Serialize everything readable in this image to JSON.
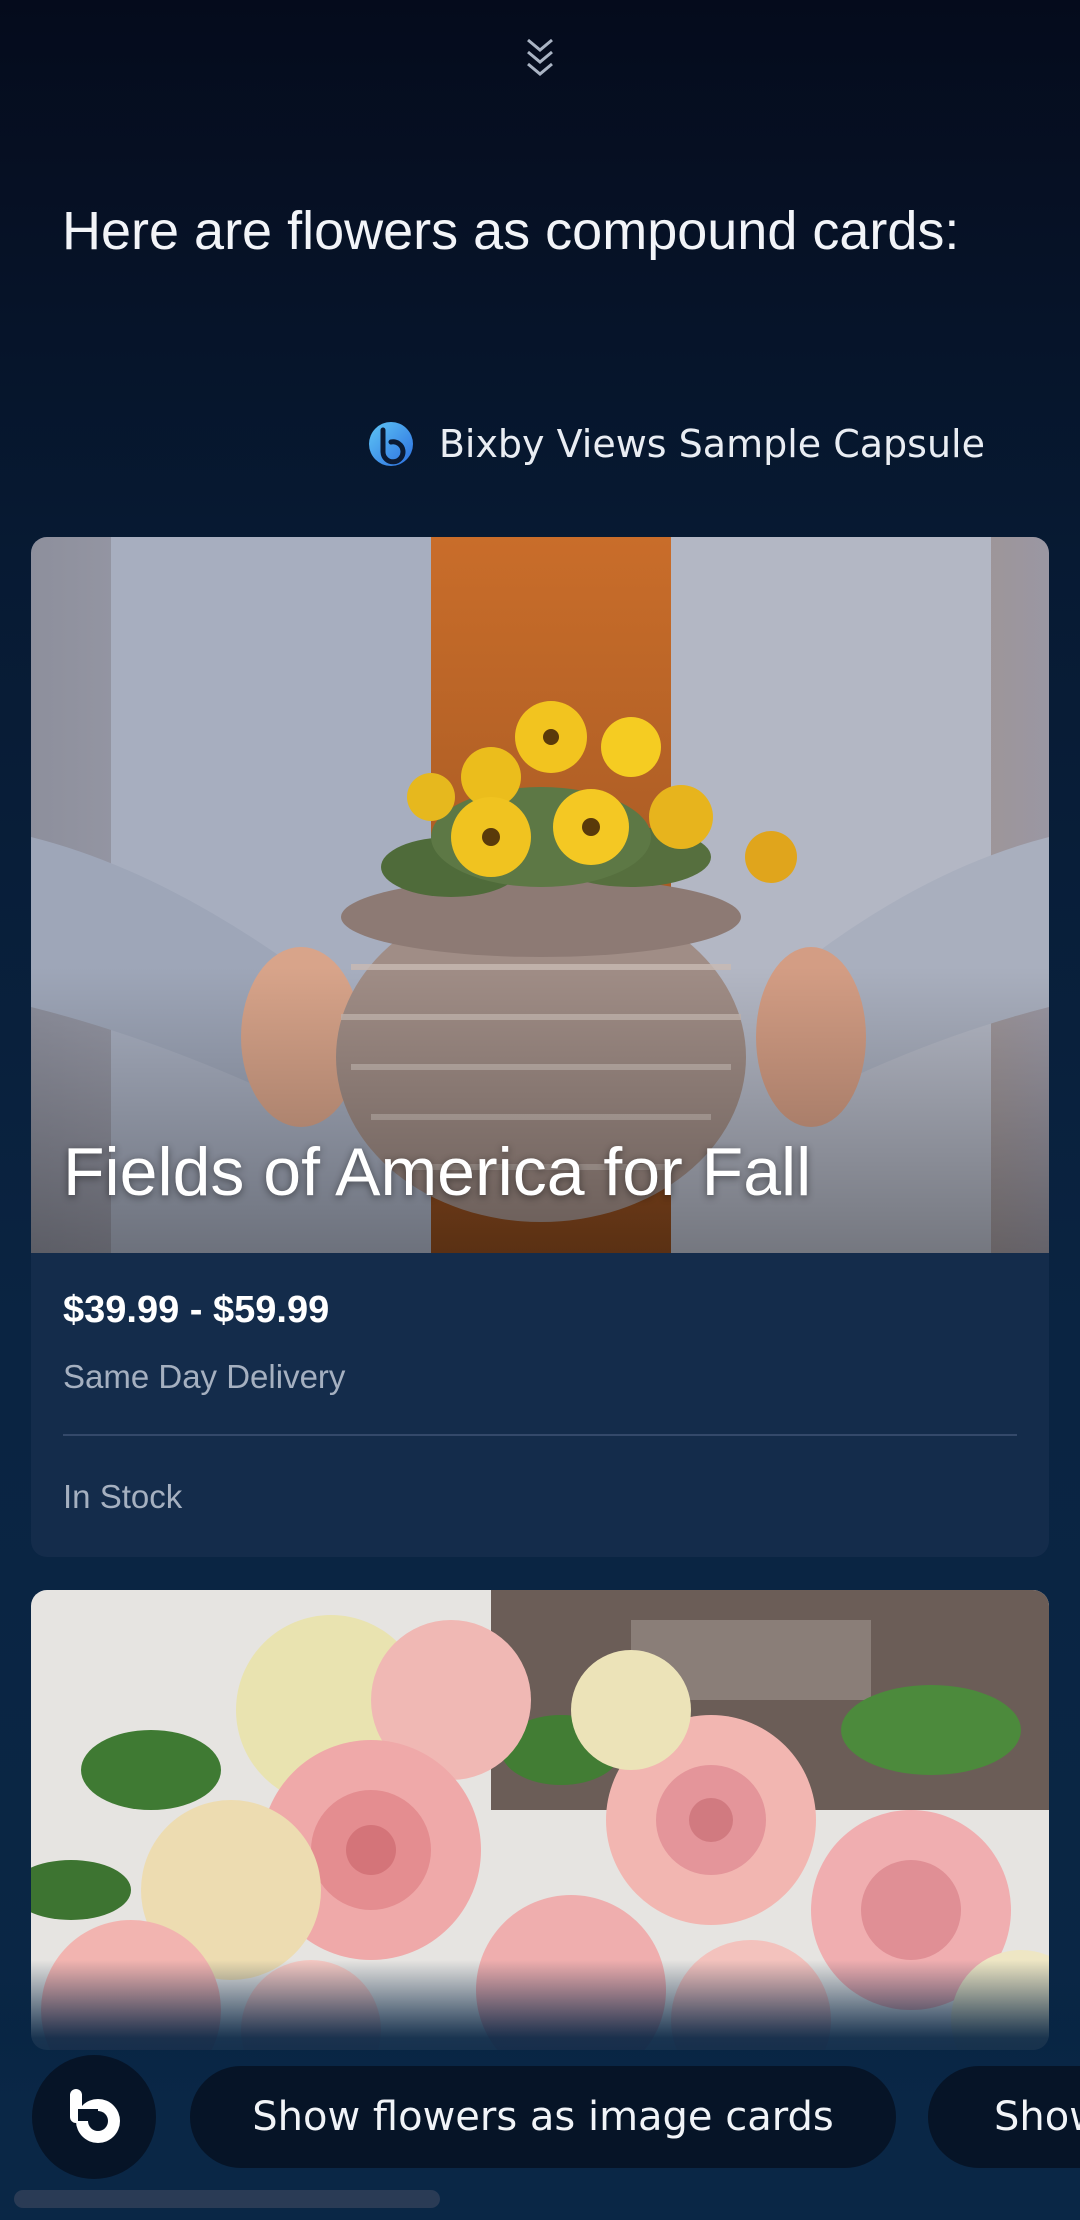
{
  "header": {
    "collapse_icon": "chevron-double-down-icon",
    "headline": "Here are flowers as compound cards:"
  },
  "capsule": {
    "icon": "bixby-icon",
    "name": "Bixby Views Sample Capsule"
  },
  "cards": [
    {
      "title": "Fields of America for Fall",
      "image": "yellow-pansies-in-wicker-basket",
      "price": "$39.99 - $59.99",
      "delivery": "Same Day Delivery",
      "stock": "In Stock"
    },
    {
      "title": "",
      "image": "pink-and-cream-roses"
    }
  ],
  "footer": {
    "bixby_button_icon": "bixby-icon",
    "chips": [
      {
        "label": "Show flowers as image cards"
      },
      {
        "label": "Show"
      }
    ]
  },
  "colors": {
    "background_top": "#050b1c",
    "background_bottom": "#0a2746",
    "card_background": "#142c4b",
    "chip_background": "#061427",
    "text_primary": "#ffffff",
    "text_secondary": "#a5b0c0",
    "bixby_blue": "#3d8ef0"
  }
}
